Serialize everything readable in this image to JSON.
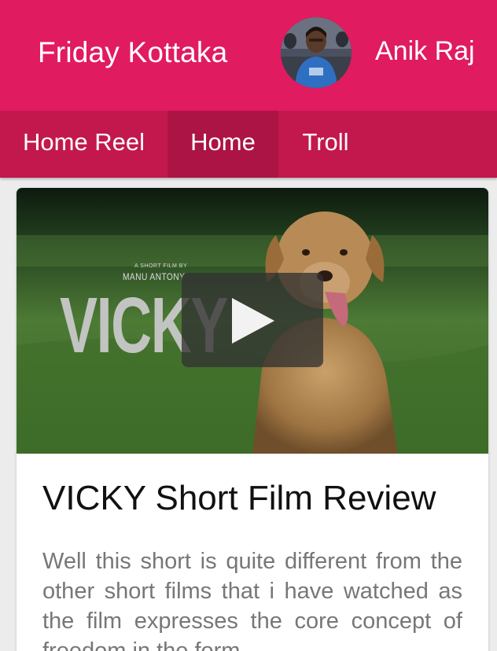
{
  "header": {
    "site_title": "Friday Kottaka",
    "user_name": "Anik Raj"
  },
  "tabs": [
    {
      "label": "Home Reel",
      "active": false
    },
    {
      "label": "Home",
      "active": true
    },
    {
      "label": "Troll",
      "active": false
    }
  ],
  "post": {
    "video": {
      "credit_small": "A SHORT FILM BY",
      "credit_name": "MANU ANTONY",
      "film_title": "VICKY"
    },
    "title": "VICKY Short Film Review",
    "excerpt": "Well this short is quite different from the other short films that i have watched as the film expresses the core concept of freedom in the form"
  },
  "colors": {
    "appbar": "#e01b5f",
    "tabbar": "#c2184e",
    "tab_active": "#ab1444"
  }
}
